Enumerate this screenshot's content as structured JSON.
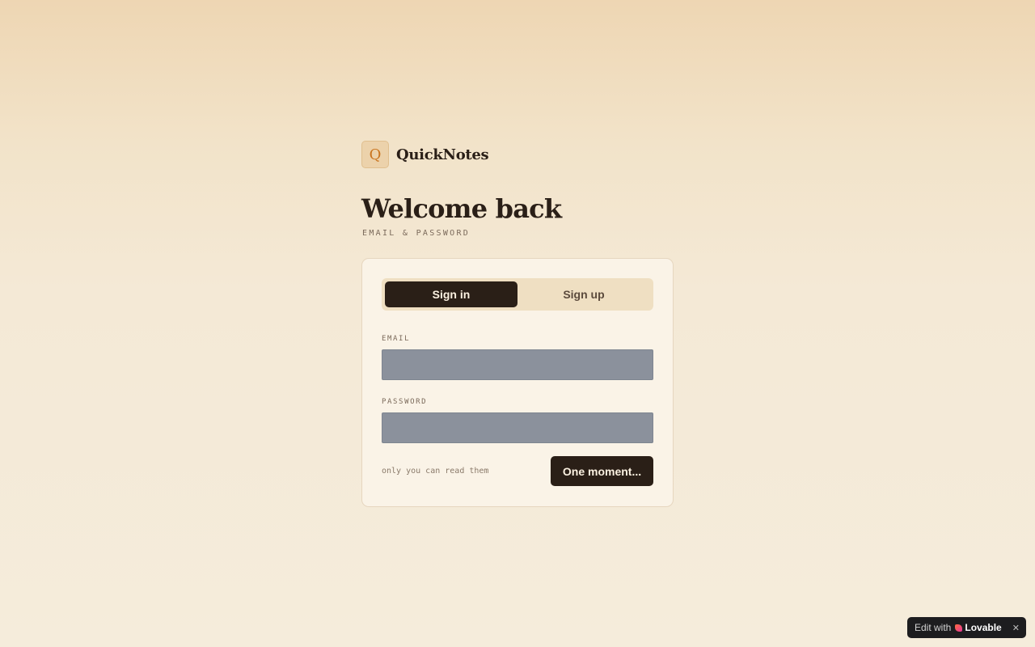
{
  "brand": {
    "logo_letter": "Q",
    "name": "QuickNotes"
  },
  "heading": {
    "title": "Welcome back",
    "subtitle": "EMAIL & PASSWORD"
  },
  "auth_tabs": {
    "sign_in": "Sign in",
    "sign_up": "Sign up",
    "active": "sign_in"
  },
  "form": {
    "email_label": "EMAIL",
    "email_value": "",
    "password_label": "PASSWORD",
    "password_value": "",
    "privacy_note": "only you can read them",
    "submit_label": "One moment..."
  },
  "badge": {
    "prefix": "Edit with",
    "brand": "Lovable",
    "icon": "lovable-heart-icon",
    "close_icon": "close-icon"
  },
  "colors": {
    "primary_dark": "#2a1f17",
    "accent": "#c9741e",
    "card_bg": "#faf3e7",
    "input_bg": "#8b919c"
  }
}
